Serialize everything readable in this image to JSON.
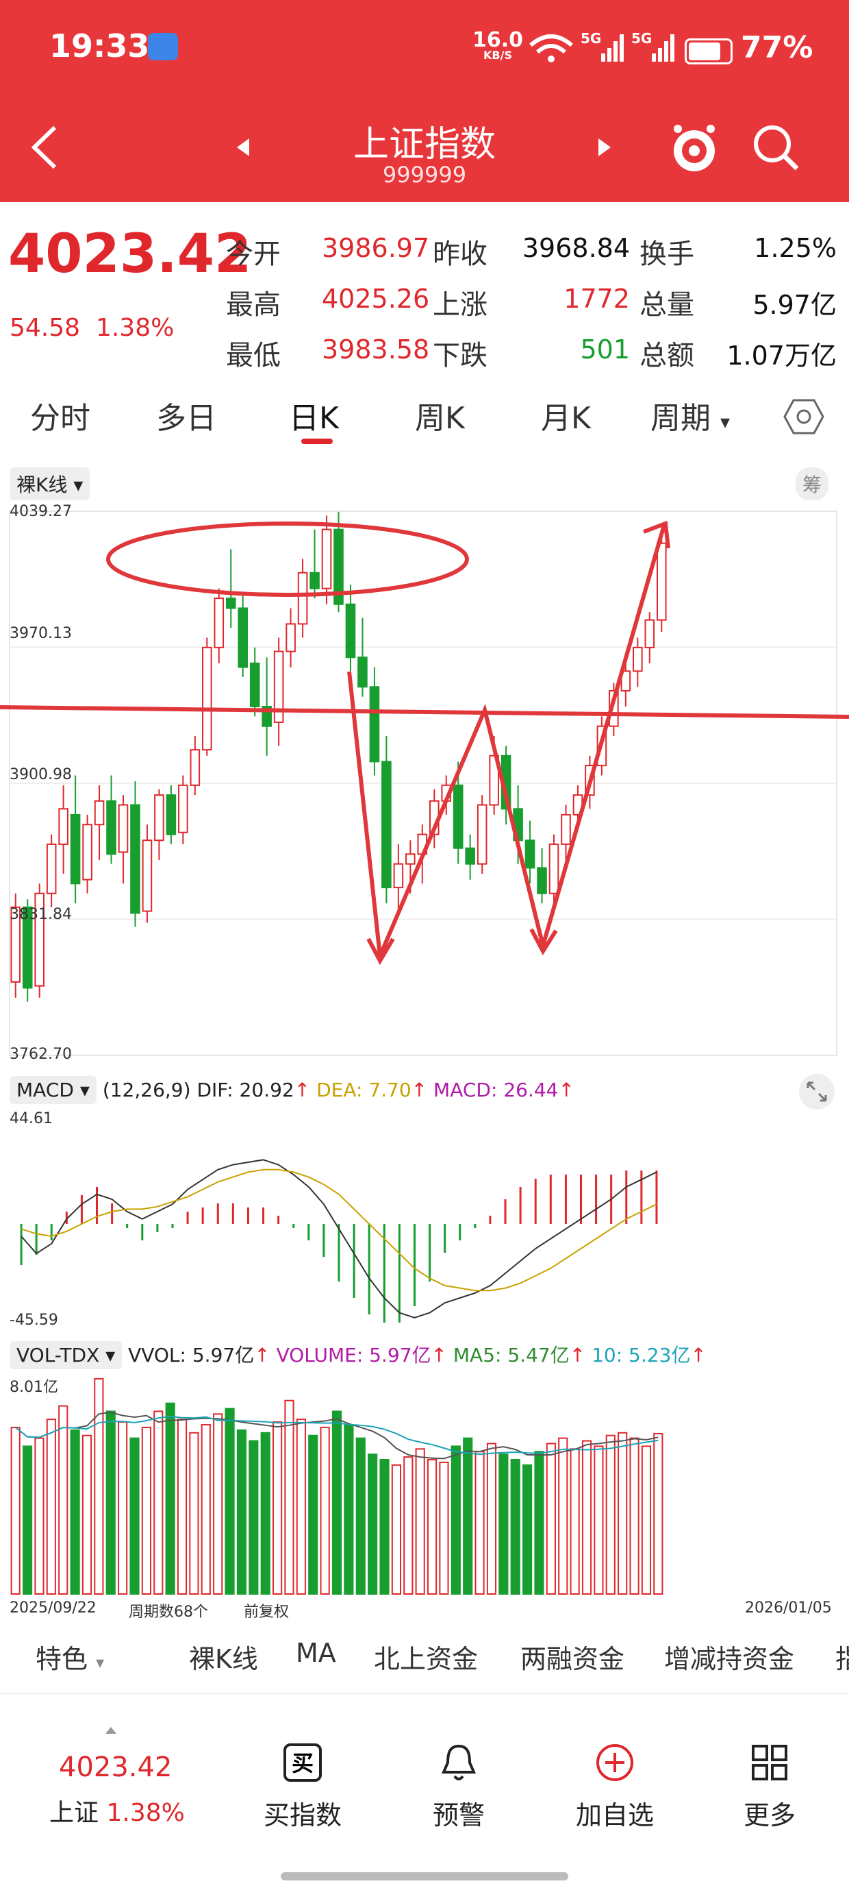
{
  "status_bar": {
    "time": "19:33",
    "net_speed": "16.0",
    "net_unit": "KB/S",
    "sig1": "5G",
    "sig2": "5G",
    "battery": "77%"
  },
  "header": {
    "title": "上证指数",
    "code": "999999"
  },
  "quote": {
    "price": "4023.42",
    "change": "54.58",
    "change_pct": "1.38%",
    "stats": [
      {
        "label": "今开",
        "value": "3986.97",
        "color": "red"
      },
      {
        "label": "昨收",
        "value": "3968.84",
        "color": "blk"
      },
      {
        "label": "换手",
        "value": "1.25%",
        "color": "blk"
      },
      {
        "label": "最高",
        "value": "4025.26",
        "color": "red"
      },
      {
        "label": "上涨",
        "value": "1772",
        "color": "red"
      },
      {
        "label": "总量",
        "value": "5.97亿",
        "color": "blk"
      },
      {
        "label": "最低",
        "value": "3983.58",
        "color": "red"
      },
      {
        "label": "下跌",
        "value": "501",
        "color": "green"
      },
      {
        "label": "总额",
        "value": "1.07万亿",
        "color": "blk"
      }
    ]
  },
  "tabs": [
    "分时",
    "多日",
    "日K",
    "周K",
    "月K",
    "周期"
  ],
  "kline": {
    "mode": "裸K线",
    "chip": "筹",
    "price_labels": [
      "4039.27",
      "3970.13",
      "3900.98",
      "3831.84",
      "3762.70"
    ]
  },
  "macd": {
    "name": "MACD",
    "params": "(12,26,9)",
    "dif": "DIF: 20.92",
    "dea": "DEA: 7.70",
    "macd": "MACD: 26.44",
    "top": "44.61",
    "bottom": "-45.59"
  },
  "vol": {
    "name": "VOL-TDX",
    "vvol": "VVOL: 5.97亿",
    "volume": "VOLUME: 5.97亿",
    "ma5": "MA5: 5.47亿",
    "ma10": "10: 5.23亿",
    "top": "8.01亿"
  },
  "axis": {
    "start_date": "2025/09/22",
    "period_count": "周期数68个",
    "adjust": "前复权",
    "end_date": "2026/01/05"
  },
  "bottom_tabs": [
    "特色",
    "裸K线",
    "MA",
    "北上资金",
    "两融资金",
    "增减持资金",
    "指"
  ],
  "footer": {
    "price": "4023.42",
    "name": "上证",
    "pct": "1.38%",
    "buttons": [
      {
        "label": "买指数",
        "icon": "buy-icon"
      },
      {
        "label": "预警",
        "icon": "bell-icon"
      },
      {
        "label": "加自选",
        "icon": "plus-circle-icon"
      },
      {
        "label": "更多",
        "icon": "grid-icon"
      }
    ]
  },
  "colors": {
    "header": "#e8373b",
    "up": "#e0272c",
    "down": "#179e2f"
  },
  "chart_data": {
    "type": "candlestick",
    "ylim": [
      3762.7,
      4039.27
    ],
    "ohlc": [
      [
        3800,
        3845,
        3792,
        3838
      ],
      [
        3838,
        3842,
        3790,
        3797
      ],
      [
        3798,
        3850,
        3792,
        3845
      ],
      [
        3845,
        3875,
        3838,
        3870
      ],
      [
        3870,
        3900,
        3855,
        3888
      ],
      [
        3885,
        3905,
        3840,
        3850
      ],
      [
        3852,
        3885,
        3845,
        3880
      ],
      [
        3880,
        3900,
        3862,
        3892
      ],
      [
        3892,
        3905,
        3860,
        3865
      ],
      [
        3866,
        3895,
        3850,
        3890
      ],
      [
        3890,
        3902,
        3828,
        3835
      ],
      [
        3836,
        3880,
        3830,
        3872
      ],
      [
        3872,
        3898,
        3862,
        3895
      ],
      [
        3895,
        3900,
        3870,
        3875
      ],
      [
        3876,
        3905,
        3870,
        3900
      ],
      [
        3900,
        3925,
        3895,
        3918
      ],
      [
        3918,
        3975,
        3915,
        3970
      ],
      [
        3970,
        4000,
        3962,
        3995
      ],
      [
        3995,
        4020,
        3980,
        3990
      ],
      [
        3990,
        3998,
        3955,
        3960
      ],
      [
        3962,
        3970,
        3935,
        3940
      ],
      [
        3940,
        3965,
        3915,
        3930
      ],
      [
        3932,
        3975,
        3920,
        3968
      ],
      [
        3968,
        3990,
        3960,
        3982
      ],
      [
        3982,
        4015,
        3975,
        4008
      ],
      [
        4008,
        4030,
        3995,
        4000
      ],
      [
        4000,
        4037,
        3992,
        4030
      ],
      [
        4030,
        4039,
        3988,
        3992
      ],
      [
        3992,
        4002,
        3958,
        3965
      ],
      [
        3965,
        3985,
        3945,
        3950
      ],
      [
        3950,
        3960,
        3905,
        3912
      ],
      [
        3912,
        3925,
        3840,
        3848
      ],
      [
        3848,
        3870,
        3835,
        3860
      ],
      [
        3860,
        3872,
        3845,
        3865
      ],
      [
        3865,
        3880,
        3850,
        3875
      ],
      [
        3875,
        3898,
        3868,
        3892
      ],
      [
        3892,
        3905,
        3885,
        3900
      ],
      [
        3900,
        3912,
        3860,
        3868
      ],
      [
        3868,
        3875,
        3852,
        3860
      ],
      [
        3860,
        3895,
        3855,
        3890
      ],
      [
        3890,
        3925,
        3885,
        3915
      ],
      [
        3915,
        3920,
        3880,
        3888
      ],
      [
        3888,
        3900,
        3860,
        3872
      ],
      [
        3872,
        3882,
        3850,
        3858
      ],
      [
        3858,
        3868,
        3840,
        3845
      ],
      [
        3845,
        3875,
        3840,
        3870
      ],
      [
        3870,
        3890,
        3860,
        3885
      ],
      [
        3885,
        3900,
        3878,
        3895
      ],
      [
        3895,
        3915,
        3888,
        3910
      ],
      [
        3910,
        3935,
        3905,
        3930
      ],
      [
        3930,
        3952,
        3925,
        3948
      ],
      [
        3948,
        3962,
        3940,
        3958
      ],
      [
        3958,
        3975,
        3950,
        3970
      ],
      [
        3970,
        3988,
        3962,
        3984
      ],
      [
        3984,
        4025,
        3978,
        4023
      ]
    ],
    "macd": {
      "dif": [
        -5,
        -12,
        -8,
        2,
        8,
        12,
        10,
        5,
        2,
        5,
        8,
        14,
        18,
        22,
        24,
        25,
        26,
        24,
        20,
        15,
        8,
        -2,
        -12,
        -22,
        -30,
        -36,
        -38,
        -36,
        -32,
        -30,
        -28,
        -25,
        -20,
        -15,
        -10,
        -6,
        -2,
        2,
        6,
        10,
        15,
        18,
        21
      ],
      "dea": [
        -2,
        -4,
        -5,
        -3,
        0,
        3,
        5,
        6,
        6,
        7,
        9,
        11,
        14,
        17,
        19,
        21,
        22,
        22,
        21,
        19,
        16,
        12,
        6,
        0,
        -6,
        -12,
        -18,
        -22,
        -25,
        -26,
        -27,
        -27,
        -26,
        -24,
        -21,
        -18,
        -14,
        -10,
        -6,
        -2,
        2,
        5,
        8
      ],
      "hist": [
        -20,
        -15,
        -8,
        6,
        14,
        18,
        10,
        -2,
        -8,
        -4,
        -2,
        6,
        8,
        10,
        10,
        8,
        8,
        4,
        -2,
        -8,
        -16,
        -28,
        -36,
        -44,
        -48,
        -48,
        -40,
        -28,
        -14,
        -8,
        -2,
        4,
        12,
        18,
        22,
        24,
        24,
        24,
        24,
        24,
        26,
        26,
        26
      ]
    },
    "volume": {
      "values": [
        6.2,
        5.5,
        5.8,
        6.5,
        7.0,
        6.1,
        5.9,
        8.01,
        6.8,
        6.4,
        5.8,
        6.2,
        6.8,
        7.1,
        6.5,
        6.0,
        6.3,
        6.7,
        6.9,
        6.1,
        5.7,
        6.0,
        6.4,
        7.2,
        6.5,
        5.9,
        6.2,
        6.8,
        6.3,
        5.8,
        5.2,
        5.0,
        4.8,
        5.1,
        5.4,
        5.0,
        4.9,
        5.5,
        5.8,
        5.3,
        5.6,
        5.2,
        5.0,
        4.8,
        5.3,
        5.6,
        5.8,
        5.4,
        5.7,
        5.5,
        5.9,
        6.0,
        5.8,
        5.5,
        5.97
      ],
      "ylim": [
        0,
        8.01
      ]
    }
  }
}
